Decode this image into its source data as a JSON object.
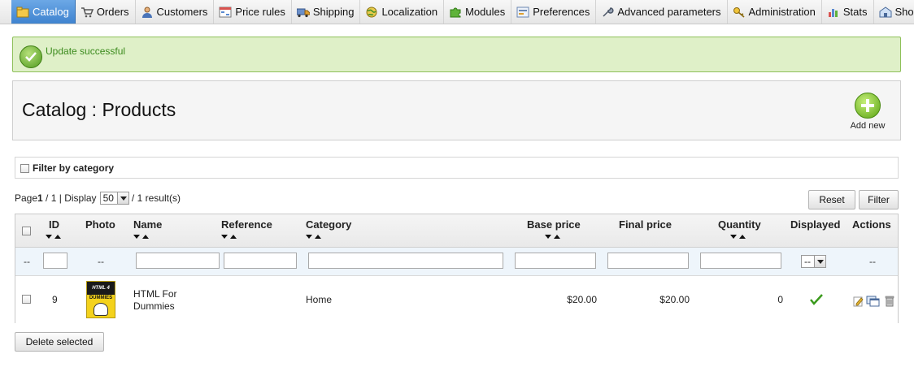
{
  "nav": {
    "tabs": [
      {
        "label": "Catalog",
        "icon": "catalog-icon",
        "active": true
      },
      {
        "label": "Orders",
        "icon": "cart-icon"
      },
      {
        "label": "Customers",
        "icon": "customer-icon"
      },
      {
        "label": "Price rules",
        "icon": "price-rules-icon"
      },
      {
        "label": "Shipping",
        "icon": "truck-icon"
      },
      {
        "label": "Localization",
        "icon": "globe-icon"
      },
      {
        "label": "Modules",
        "icon": "puzzle-icon"
      },
      {
        "label": "Preferences",
        "icon": "preferences-icon"
      },
      {
        "label": "Advanced parameters",
        "icon": "wrench-icon"
      },
      {
        "label": "Administration",
        "icon": "key-icon"
      },
      {
        "label": "Stats",
        "icon": "chart-icon"
      },
      {
        "label": "Shops",
        "icon": "shop-icon"
      }
    ]
  },
  "alert": {
    "message": "Update successful"
  },
  "header": {
    "title": "Catalog : Products",
    "add_new": "Add new"
  },
  "filter_category": {
    "label": "Filter by category"
  },
  "pagination": {
    "page_label": "Page",
    "page_current": "1",
    "page_sep": " / ",
    "page_total": "1",
    "display_label": " | Display",
    "per_page": "50",
    "results": "/ 1 result(s)"
  },
  "buttons": {
    "reset": "Reset",
    "filter": "Filter",
    "delete_selected": "Delete selected"
  },
  "table": {
    "columns": {
      "id": "ID",
      "photo": "Photo",
      "name": "Name",
      "reference": "Reference",
      "category": "Category",
      "base_price": "Base price",
      "final_price": "Final price",
      "quantity": "Quantity",
      "displayed": "Displayed",
      "actions": "Actions"
    },
    "filter_row": {
      "empty": "--",
      "displayed_select": "--"
    },
    "rows": [
      {
        "id": "9",
        "photo_text_top": "HTML 4",
        "photo_text_mid": "DUMMIES",
        "name_line1": "HTML For",
        "name_line2": "Dummies",
        "reference": "",
        "category": "Home",
        "base_price": "$20.00",
        "final_price": "$20.00",
        "quantity": "0",
        "displayed": true
      }
    ]
  },
  "colors": {
    "accent": "#3f83cf",
    "success_bg": "#dff0c8",
    "success_text": "#3a8a1c"
  }
}
